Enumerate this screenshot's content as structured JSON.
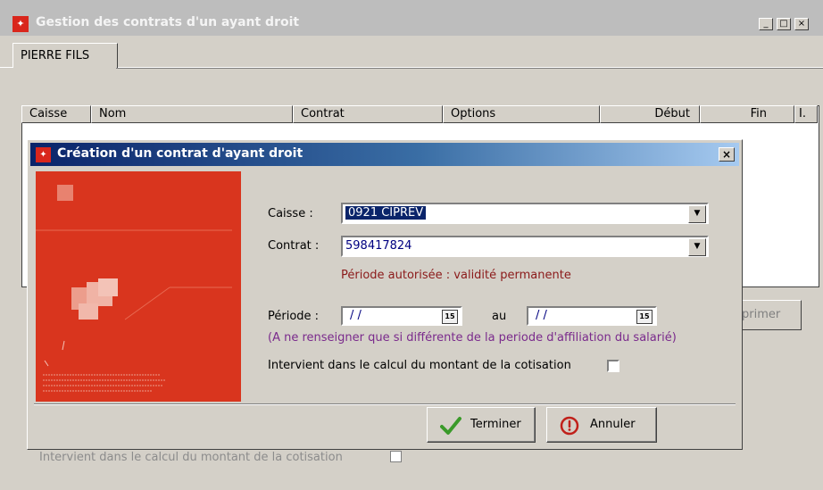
{
  "window": {
    "title": "Gestion des contrats d'un ayant droit",
    "controls": [
      "_",
      "□",
      "×"
    ]
  },
  "tabs": [
    {
      "label": "PIERRE FILS"
    }
  ],
  "table": {
    "columns": [
      "Caisse",
      "Nom",
      "Contrat",
      "Options",
      "Début",
      "Fin",
      "I."
    ]
  },
  "background": {
    "partial_button": "primer",
    "checkbox_label": "Intervient dans le calcul du montant de la cotisation"
  },
  "dialog": {
    "title": "Création d'un contrat d'ayant droit",
    "close": "×",
    "caisse": {
      "label": "Caisse :",
      "value": "0921 CIPREV"
    },
    "contrat": {
      "label": "Contrat :",
      "value": "598417824"
    },
    "periode_info": "Période autorisée : validité permanente",
    "periode": {
      "label": "Période :",
      "from": "/ /",
      "to_label": "au",
      "to": "/ /",
      "calendar_text": "15"
    },
    "periode_note": "(A ne renseigner que si différente de la periode d'affiliation du salarié)",
    "checkbox_label": "Intervient dans le calcul du montant de la cotisation",
    "buttons": {
      "ok": "Terminer",
      "cancel": "Annuler"
    },
    "colors": {
      "accent_red": "#d9351e",
      "info_text": "#8b1a1a",
      "note_text": "#7a2a8c",
      "ok_green": "#3a9a2a",
      "cancel_red": "#c0201a"
    }
  }
}
